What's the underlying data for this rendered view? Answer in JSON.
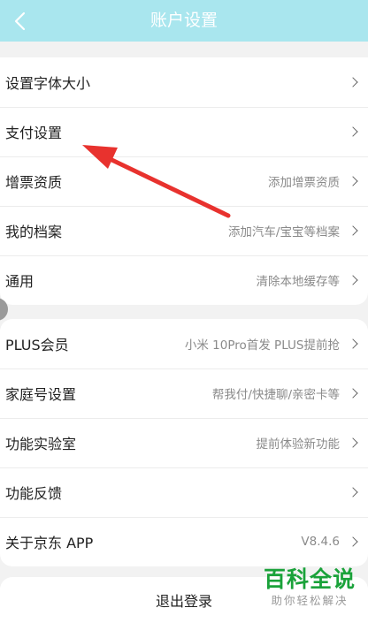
{
  "header": {
    "title": "账户设置",
    "background_color": "#a9e6ee",
    "back_icon": "chevron-left-icon"
  },
  "settings_group_1": [
    {
      "label": "设置字体大小",
      "value": ""
    },
    {
      "label": "支付设置",
      "value": ""
    },
    {
      "label": "增票资质",
      "value": "添加增票资质"
    },
    {
      "label": "我的档案",
      "value": "添加汽车/宝宝等档案"
    },
    {
      "label": "通用",
      "value": "清除本地缓存等"
    }
  ],
  "settings_group_2": [
    {
      "label": "PLUS会员",
      "value": "小米 10Pro首发 PLUS提前抢"
    },
    {
      "label": "家庭号设置",
      "value": "帮我付/快捷聊/亲密卡等"
    },
    {
      "label": "功能实验室",
      "value": "提前体验新功能"
    },
    {
      "label": "功能反馈",
      "value": ""
    },
    {
      "label": "关于京东 APP",
      "value": "V8.4.6"
    }
  ],
  "logout": {
    "label": "退出登录"
  },
  "watermark": {
    "logo_text": "百科全说",
    "subtitle": "助你轻松解决",
    "color": "#1aa23a"
  },
  "annotation": {
    "arrow_color": "#e8322e",
    "points_to": "支付设置"
  }
}
